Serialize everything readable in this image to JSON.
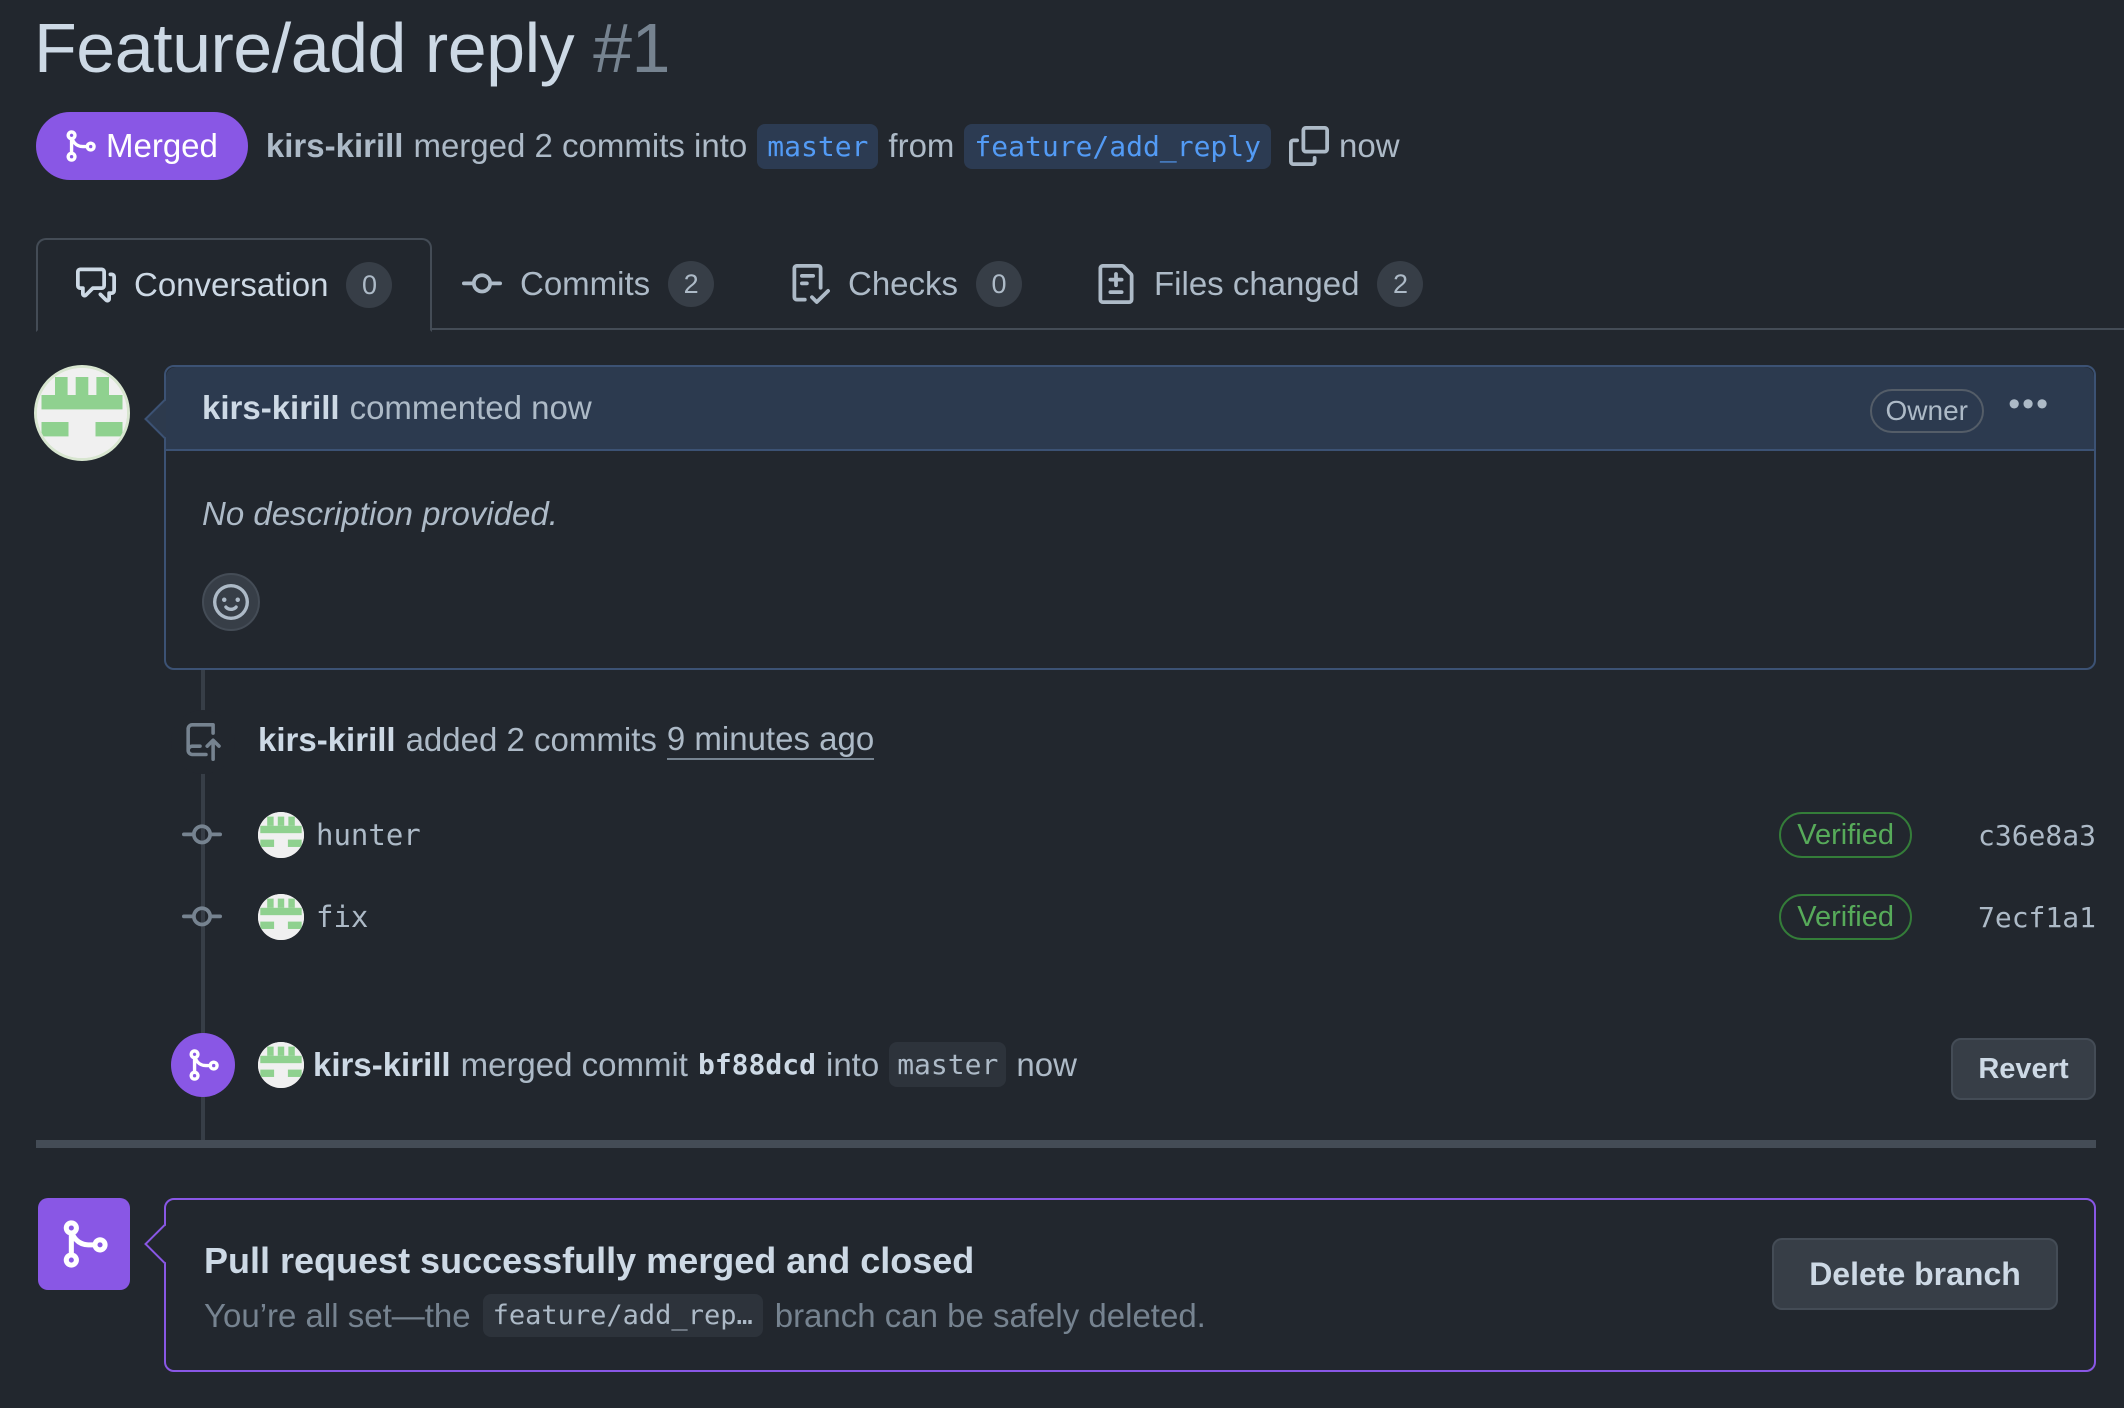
{
  "pr": {
    "title": "Feature/add reply",
    "number": "#1",
    "state": "Merged",
    "author": "kirs-kirill",
    "summary_merged": "merged 2 commits into",
    "base_branch": "master",
    "from_text": "from",
    "head_branch": "feature/add_reply",
    "time": "now"
  },
  "tabs": [
    {
      "label": "Conversation",
      "count": "0"
    },
    {
      "label": "Commits",
      "count": "2"
    },
    {
      "label": "Checks",
      "count": "0"
    },
    {
      "label": "Files changed",
      "count": "2"
    }
  ],
  "comment": {
    "author": "kirs-kirill",
    "action": "commented now",
    "badge": "Owner",
    "body": "No description provided."
  },
  "commits_event": {
    "author": "kirs-kirill",
    "action": "added 2 commits",
    "time": "9 minutes ago"
  },
  "commits": [
    {
      "message": "hunter",
      "verified": "Verified",
      "sha": "c36e8a3"
    },
    {
      "message": "fix",
      "verified": "Verified",
      "sha": "7ecf1a1"
    }
  ],
  "merge_event": {
    "author": "kirs-kirill",
    "action": "merged commit",
    "commit": "bf88dcd",
    "into": "into",
    "branch": "master",
    "time": "now",
    "revert_label": "Revert"
  },
  "merged_box": {
    "title": "Pull request successfully merged and closed",
    "sub_prefix": "You’re all set—the",
    "branch": "feature/add_rep…",
    "sub_suffix": "branch can be safely deleted.",
    "delete_label": "Delete branch"
  },
  "colors": {
    "background": "#22272e",
    "merged_purple": "#8957e5",
    "link_blue": "#539bf5",
    "verified_green": "#57ab5a"
  }
}
